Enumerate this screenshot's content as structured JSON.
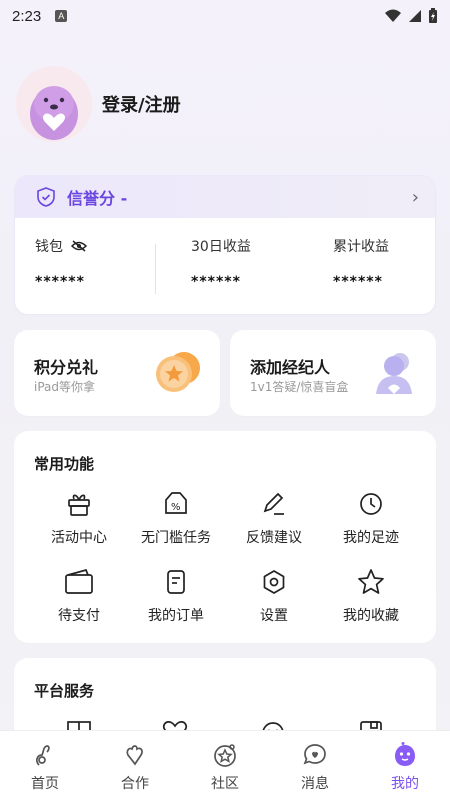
{
  "status": {
    "time": "2:23",
    "a_badge": "A"
  },
  "profile": {
    "login_label": "登录/注册"
  },
  "credit": {
    "title": "信誉分 -",
    "stats": [
      {
        "label": "钱包",
        "value": "******"
      },
      {
        "label": "30日收益",
        "value": "******"
      },
      {
        "label": "累计收益",
        "value": "******"
      }
    ]
  },
  "promo": [
    {
      "title": "积分兑礼",
      "subtitle": "iPad等你拿"
    },
    {
      "title": "添加经纪人",
      "subtitle": "1v1答疑/惊喜盲盒"
    }
  ],
  "common": {
    "title": "常用功能",
    "items": [
      {
        "label": "活动中心",
        "icon": "gift-icon"
      },
      {
        "label": "无门槛任务",
        "icon": "discount-tag-icon"
      },
      {
        "label": "反馈建议",
        "icon": "pencil-icon"
      },
      {
        "label": "我的足迹",
        "icon": "clock-icon"
      },
      {
        "label": "待支付",
        "icon": "wallet-icon"
      },
      {
        "label": "我的订单",
        "icon": "order-icon"
      },
      {
        "label": "设置",
        "icon": "settings-icon"
      },
      {
        "label": "我的收藏",
        "icon": "star-icon"
      }
    ]
  },
  "platform": {
    "title": "平台服务"
  },
  "tabs": [
    {
      "label": "首页",
      "icon": "home-icon"
    },
    {
      "label": "合作",
      "icon": "handshake-icon"
    },
    {
      "label": "社区",
      "icon": "community-icon"
    },
    {
      "label": "消息",
      "icon": "message-icon"
    },
    {
      "label": "我的",
      "icon": "mine-icon"
    }
  ],
  "colors": {
    "accent": "#7b50f0",
    "credit_title": "#6b46e0"
  }
}
